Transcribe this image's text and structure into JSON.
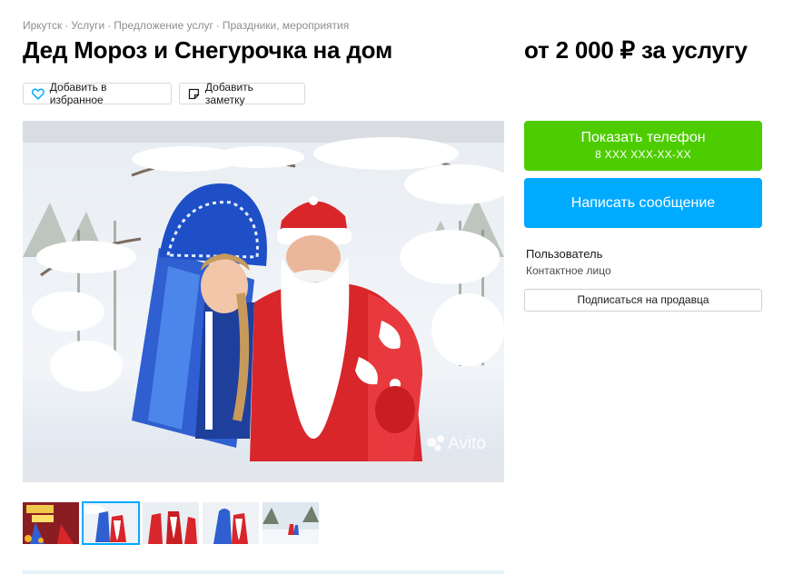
{
  "breadcrumbs": [
    "Иркутск",
    "Услуги",
    "Предложение услуг",
    "Праздники, мероприятия"
  ],
  "breadcrumb_separator": "·",
  "listing": {
    "title": "Дед Мороз и Снегурочка на дом",
    "price": "от 2 000 ₽ за услугу"
  },
  "actions": {
    "favorite_label": "Добавить в избранное",
    "note_label": "Добавить заметку"
  },
  "photo": {
    "watermark": "Avito"
  },
  "contact": {
    "phone_label": "Показать телефон",
    "phone_masked": "8 XXX XXX-XX-XX",
    "message_label": "Написать сообщение"
  },
  "seller": {
    "name": "Пользователь",
    "role": "Контактное лицо",
    "subscribe_label": "Подписаться на продавца"
  },
  "colors": {
    "phone_button": "#4dcc00",
    "message_button": "#00aaff",
    "favorite_icon": "#00aaff",
    "active_thumb_border": "#00aaff"
  },
  "thumbnails": [
    {
      "name": "thumb-1",
      "active": false
    },
    {
      "name": "thumb-2",
      "active": true
    },
    {
      "name": "thumb-3",
      "active": false
    },
    {
      "name": "thumb-4",
      "active": false
    },
    {
      "name": "thumb-5",
      "active": false
    }
  ]
}
